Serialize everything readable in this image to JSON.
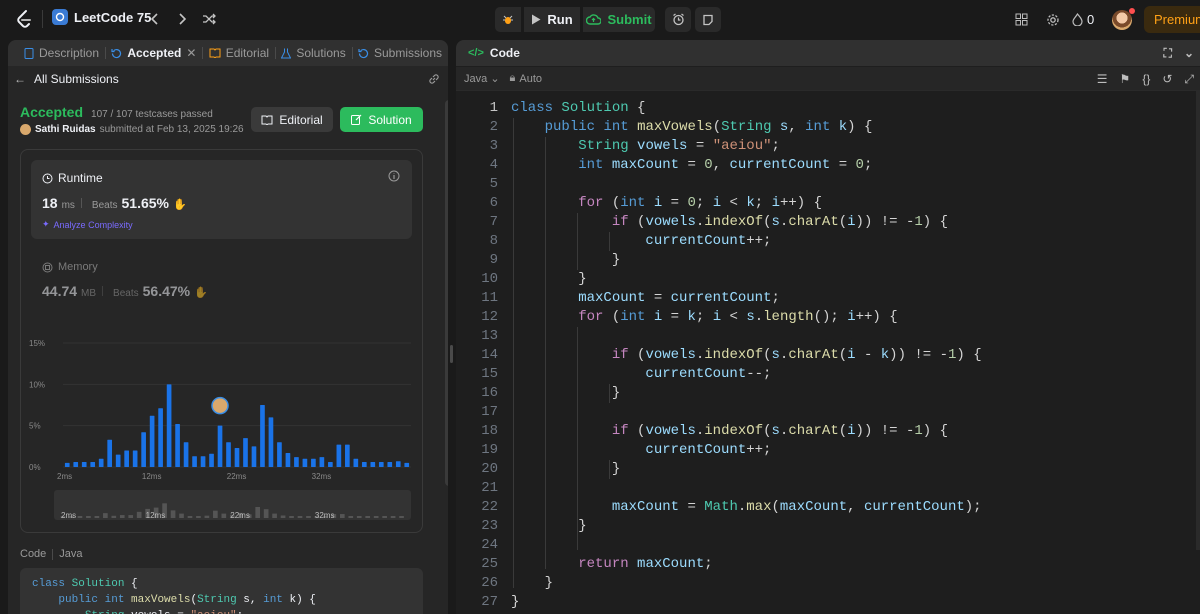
{
  "topbar": {
    "study_plan": "LeetCode 75",
    "run_label": "Run",
    "submit_label": "Submit",
    "streak": "0",
    "premium_label": "Premium"
  },
  "left": {
    "tabs": [
      {
        "label": "Description",
        "icon": "description-icon"
      },
      {
        "label": "Accepted",
        "icon": "history-icon"
      },
      {
        "label": "Editorial",
        "icon": "book-icon"
      },
      {
        "label": "Solutions",
        "icon": "flask-icon"
      },
      {
        "label": "Submissions",
        "icon": "history-icon"
      }
    ],
    "back_label": "All Submissions",
    "status": "Accepted",
    "testcases": "107 / 107 testcases passed",
    "username": "Sathi Ruidas",
    "submitted_text": "submitted at Feb 13, 2025 19:26",
    "editorial_btn": "Editorial",
    "solution_btn": "Solution",
    "runtime": {
      "title": "Runtime",
      "value": "18",
      "unit": "ms",
      "beats_label": "Beats",
      "beats": "51.65%",
      "analyze": "Analyze Complexity"
    },
    "memory": {
      "title": "Memory",
      "value": "44.74",
      "unit": "MB",
      "beats_label": "Beats",
      "beats": "56.47%"
    },
    "code_tab": "Code",
    "code_lang": "Java",
    "preview_lines": [
      "class Solution {",
      "    public int maxVowels(String s, int k) {",
      "        String vowels = \"aeiou\";"
    ]
  },
  "chart_data": {
    "type": "bar",
    "yticks": [
      "15%",
      "10%",
      "5%",
      "0%"
    ],
    "ylim": [
      0,
      15
    ],
    "xticks": [
      "2ms",
      "12ms",
      "22ms",
      "32ms"
    ],
    "values": [
      0.5,
      0.6,
      0.6,
      0.6,
      1.0,
      3.3,
      1.5,
      2.0,
      2.0,
      4.2,
      6.2,
      7.1,
      10.0,
      5.2,
      3.0,
      1.3,
      1.3,
      1.6,
      5.0,
      3.0,
      2.3,
      3.5,
      2.5,
      7.5,
      6.0,
      3.0,
      1.7,
      1.2,
      1.0,
      1.0,
      1.2,
      0.6,
      2.7,
      2.7,
      1.0,
      0.6,
      0.6,
      0.6,
      0.6,
      0.7,
      0.5
    ],
    "highlight_index": 18,
    "mini_xticks": [
      "2ms",
      "12ms",
      "22ms",
      "32ms"
    ]
  },
  "editor": {
    "title": "Code",
    "language": "Java",
    "mode": "Auto",
    "current_line": 1
  },
  "colors": {
    "accepted": "#2cbb5d",
    "bar": "#1a73e8",
    "premium": "#ffa116",
    "keyword": "#569cd6",
    "type": "#4ec9b0"
  }
}
